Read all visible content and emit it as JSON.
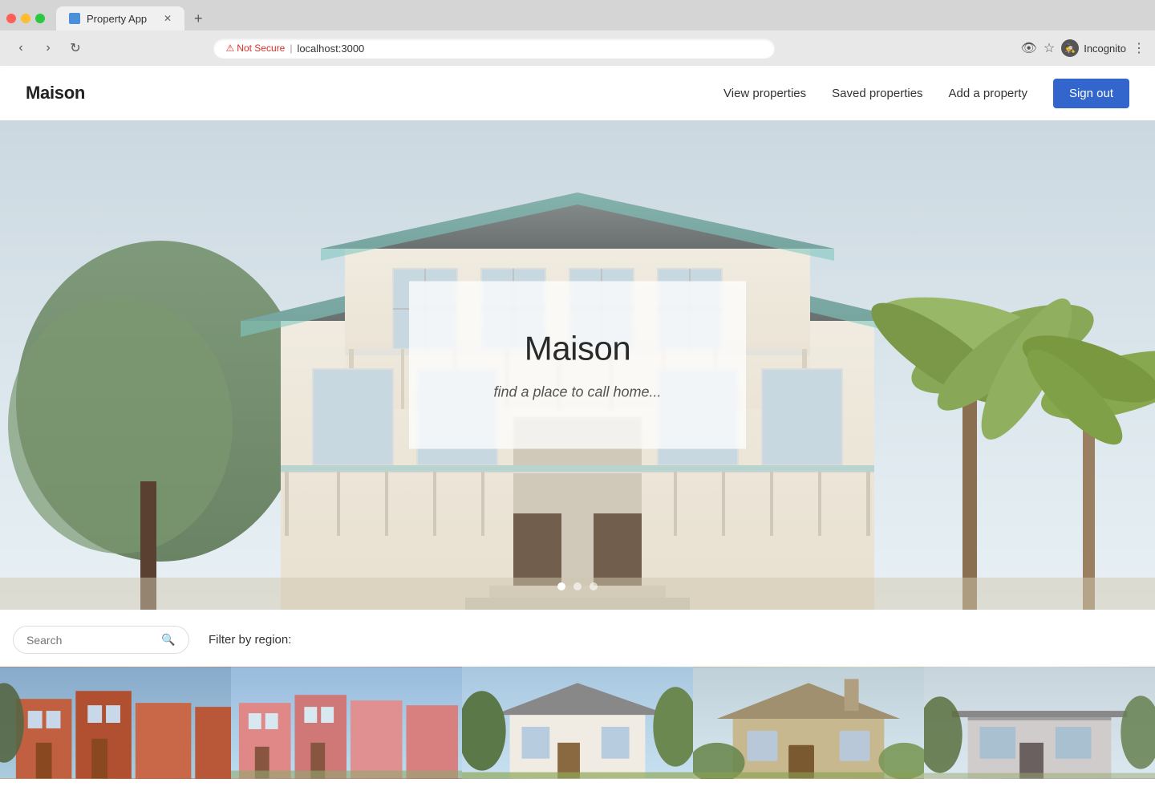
{
  "browser": {
    "tab_title": "Property App",
    "new_tab_label": "+",
    "security_label": "Not Secure",
    "url": "localhost:3000",
    "incognito_label": "Incognito"
  },
  "navbar": {
    "logo": "Maison",
    "links": [
      {
        "id": "view-properties",
        "label": "View properties"
      },
      {
        "id": "saved-properties",
        "label": "Saved properties"
      },
      {
        "id": "add-property",
        "label": "Add a property"
      }
    ],
    "sign_out_label": "Sign out"
  },
  "hero": {
    "title": "Maison",
    "subtitle": "find a place to call home...",
    "dots": [
      {
        "active": true
      },
      {
        "active": false
      },
      {
        "active": false
      }
    ]
  },
  "search": {
    "placeholder": "Search",
    "filter_label": "Filter by region:"
  },
  "property_cards": [
    {
      "id": 1,
      "alt": "Red brick townhouses"
    },
    {
      "id": 2,
      "alt": "Pink row houses"
    },
    {
      "id": 3,
      "alt": "White suburban house"
    },
    {
      "id": 4,
      "alt": "Stone cottage"
    },
    {
      "id": 5,
      "alt": "Grey house"
    }
  ]
}
